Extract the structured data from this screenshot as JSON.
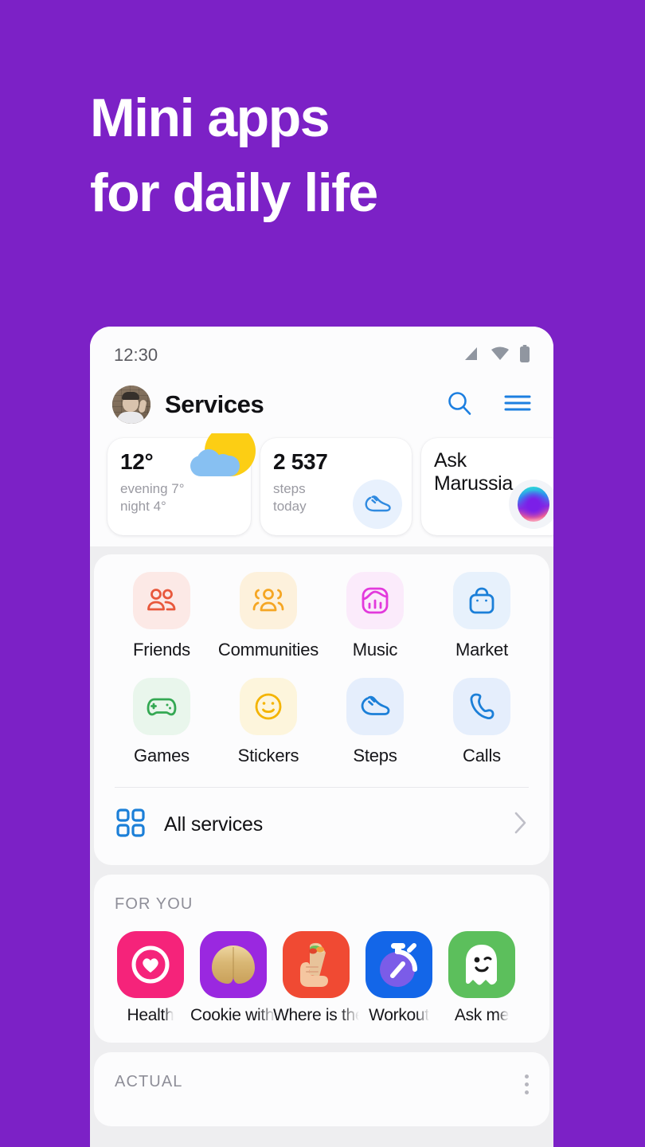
{
  "promo": {
    "line1": "Mini apps",
    "line2": "for daily life",
    "background_color": "#7C21C6"
  },
  "statusbar": {
    "time": "12:30",
    "icons": [
      "signal-icon",
      "wifi-icon",
      "battery-icon"
    ]
  },
  "header": {
    "title": "Services",
    "avatar": "user-avatar",
    "search_icon": "search-icon",
    "menu_icon": "hamburger-menu-icon",
    "accent_color": "#1D7FE0"
  },
  "widgets": [
    {
      "name": "weather",
      "temperature": "12°",
      "detail_line1": "evening 7°",
      "detail_line2": "night 4°",
      "icon": "sun-cloud-icon"
    },
    {
      "name": "steps",
      "count": "2 537",
      "detail_line1": "steps",
      "detail_line2": "today",
      "icon": "sneaker-icon"
    },
    {
      "name": "assistant",
      "title_line1": "Ask",
      "title_line2": "Marussia",
      "icon": "assistant-orb-icon"
    }
  ],
  "services": {
    "tiles": [
      {
        "label": "Friends",
        "icon": "people-icon",
        "bg": "#FCE9E6",
        "fg": "#E8583C"
      },
      {
        "label": "Communities",
        "icon": "group-icon",
        "bg": "#FDF1DC",
        "fg": "#F5A623"
      },
      {
        "label": "Music",
        "icon": "equalizer-icon",
        "bg": "#FBEBFB",
        "fg": "#E239DC"
      },
      {
        "label": "Market",
        "icon": "shopping-bag-icon",
        "bg": "#E7F1FC",
        "fg": "#1B7FD8"
      },
      {
        "label": "Games",
        "icon": "gamepad-icon",
        "bg": "#E9F6EC",
        "fg": "#34A853"
      },
      {
        "label": "Stickers",
        "icon": "smiley-icon",
        "bg": "#FDF5DC",
        "fg": "#F4B400"
      },
      {
        "label": "Steps",
        "icon": "sneaker-icon",
        "bg": "#E5EEFC",
        "fg": "#1B7FD8"
      },
      {
        "label": "Calls",
        "icon": "phone-icon",
        "bg": "#E5EEFC",
        "fg": "#1B7FD8"
      }
    ],
    "all_services_label": "All services",
    "all_services_icon": "grid-icon",
    "chevron_icon": "chevron-right-icon"
  },
  "for_you": {
    "section_title": "FOR YOU",
    "apps": [
      {
        "label": "Health",
        "icon": "health-heart-icon",
        "bg": "#F5237A"
      },
      {
        "label": "Cookie with wish",
        "icon": "fortune-cookie-icon",
        "bg": "#9A28E0"
      },
      {
        "label": "Where is the food",
        "icon": "shawarma-hand-icon",
        "bg": "#F04A33"
      },
      {
        "label": "Workout",
        "icon": "stopwatch-icon",
        "bg": "#1366E8"
      },
      {
        "label": "Ask me",
        "icon": "ghost-icon",
        "bg": "#5CBF5C"
      }
    ]
  },
  "actual": {
    "section_title": "ACTUAL",
    "menu_icon": "kebab-menu-icon"
  }
}
